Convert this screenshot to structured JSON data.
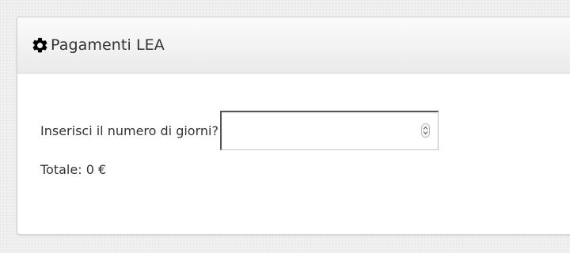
{
  "panel": {
    "title": "Pagamenti LEA",
    "icon": "gear-icon"
  },
  "form": {
    "days_label": "Inserisci il numero di giorni?",
    "days_value": "",
    "days_placeholder": ""
  },
  "total": {
    "text": "Totale: 0 €"
  }
}
